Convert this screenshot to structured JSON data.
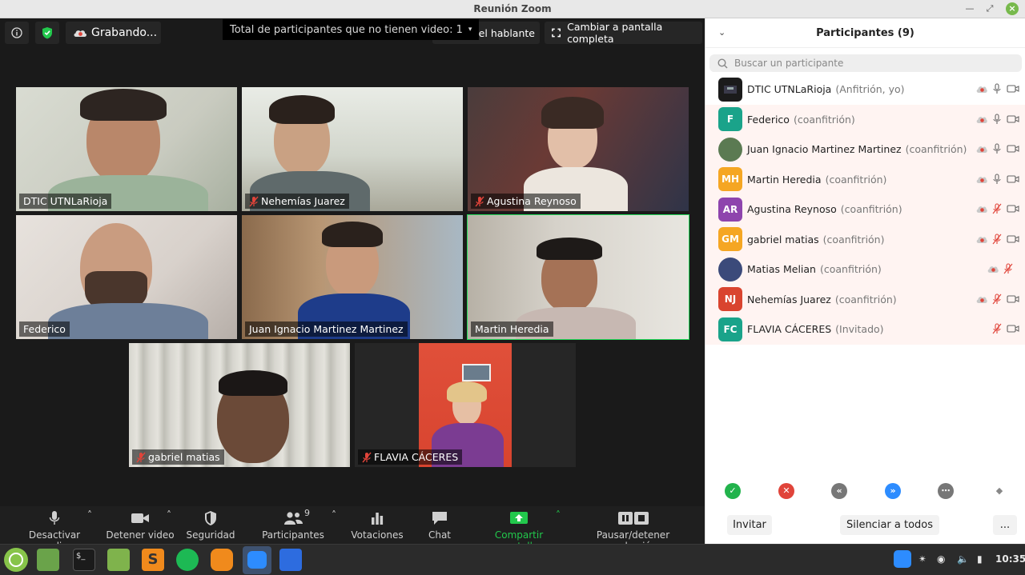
{
  "window": {
    "title": "Reunión Zoom"
  },
  "topbar": {
    "recording_label": "Grabando...",
    "tooltip": "Total de participantes que no tienen video: 1",
    "speaker_view_label": "del hablante",
    "fullscreen_label": "Cambiar a pantalla completa"
  },
  "tiles": [
    {
      "name": "DTIC UTNLaRioja",
      "muted": false
    },
    {
      "name": "Nehemías Juarez",
      "muted": true
    },
    {
      "name": "Agustina Reynoso",
      "muted": true
    },
    {
      "name": "Federico",
      "muted": false
    },
    {
      "name": "Juan Ignacio Martinez Martinez",
      "muted": false
    },
    {
      "name": "Martin Heredia",
      "muted": false
    },
    {
      "name": "gabriel matias",
      "muted": true
    },
    {
      "name": "FLAVIA CÁCERES",
      "muted": true
    }
  ],
  "toolbar": {
    "audio": "Desactivar audio",
    "video": "Detener video",
    "security": "Seguridad",
    "participants": "Participantes",
    "participants_count": "9",
    "polls": "Votaciones",
    "chat": "Chat",
    "share": "Compartir pantalla",
    "record": "Pausar/detener grabación"
  },
  "panel": {
    "title": "Participantes (9)",
    "search_placeholder": "Buscar un participante",
    "participants": [
      {
        "initials": "",
        "name": "DTIC UTNLaRioja",
        "role": "(Anfitrión, yo)",
        "color": "#1b1b1b"
      },
      {
        "initials": "F",
        "name": "Federico",
        "role": "(coanfitrión)",
        "color": "#1aa38a"
      },
      {
        "initials": "",
        "name": "Juan Ignacio Martinez Martinez",
        "role": "(coanfitrión)",
        "color": "#5b7a52"
      },
      {
        "initials": "MH",
        "name": "Martin Heredia",
        "role": "(coanfitrión)",
        "color": "#f5a623"
      },
      {
        "initials": "AR",
        "name": "Agustina Reynoso",
        "role": "(coanfitrión)",
        "color": "#8e44ad"
      },
      {
        "initials": "GM",
        "name": "gabriel matias",
        "role": "(coanfitrión)",
        "color": "#f5a623"
      },
      {
        "initials": "",
        "name": "Matias Melian",
        "role": "(coanfitrión)",
        "color": "#3b4a7a"
      },
      {
        "initials": "NJ",
        "name": "Nehemías Juarez",
        "role": "(coanfitrión)",
        "color": "#d9442f"
      },
      {
        "initials": "FC",
        "name": "FLAVIA CÁCERES",
        "role": "(Invitado)",
        "color": "#1aa38a"
      }
    ],
    "invite_label": "Invitar",
    "mute_all_label": "Silenciar a todos",
    "more_label": "..."
  },
  "taskbar": {
    "clock": "10:35"
  }
}
